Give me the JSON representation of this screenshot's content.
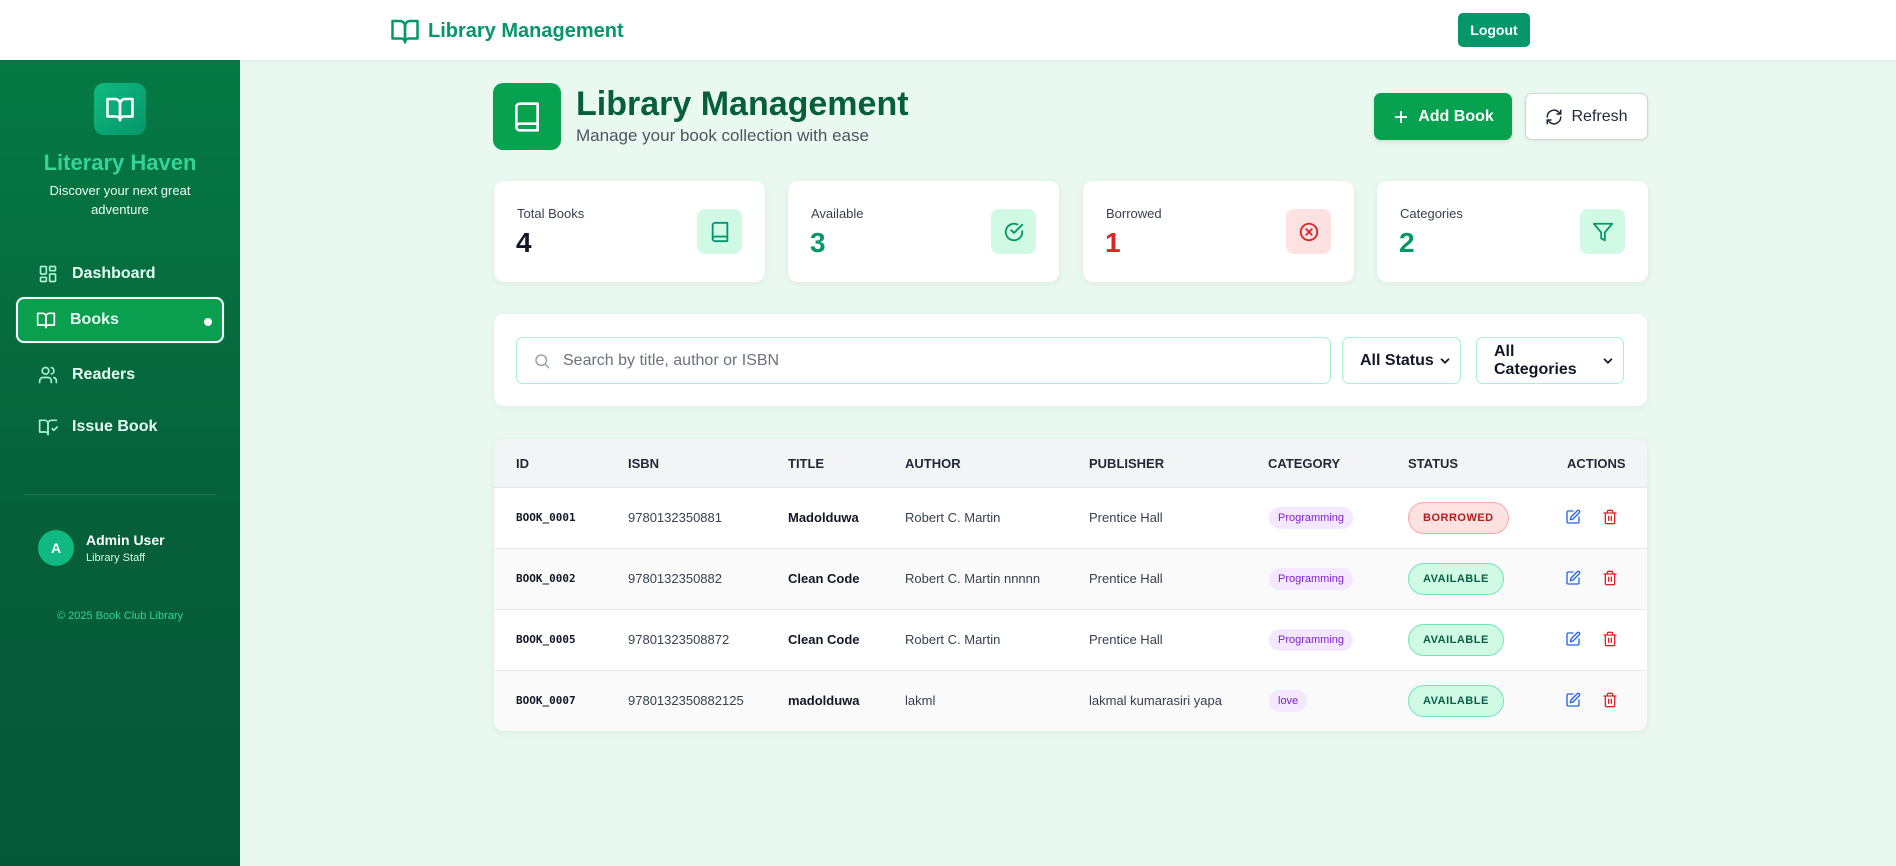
{
  "topbar": {
    "brand": "Library Management",
    "logout_label": "Logout"
  },
  "sidebar": {
    "title": "Literary Haven",
    "subtitle": "Discover your next great adventure",
    "items": [
      {
        "label": "Dashboard",
        "icon": "dashboard-icon"
      },
      {
        "label": "Books",
        "icon": "book-open-icon",
        "active": true
      },
      {
        "label": "Readers",
        "icon": "users-icon"
      },
      {
        "label": "Issue Book",
        "icon": "book-issue-icon"
      }
    ],
    "user": {
      "initial": "A",
      "name": "Admin User",
      "role": "Library Staff"
    },
    "copyright": "© 2025 Book Club Library"
  },
  "header": {
    "title": "Library Management",
    "subtitle": "Manage your book collection with ease",
    "add_label": "Add Book",
    "refresh_label": "Refresh"
  },
  "stats": [
    {
      "label": "Total Books",
      "value": "4",
      "color": "#111827",
      "icon": "book-icon"
    },
    {
      "label": "Available",
      "value": "3",
      "color": "#059669",
      "icon": "check-circle-icon"
    },
    {
      "label": "Borrowed",
      "value": "1",
      "color": "#dc2626",
      "icon": "x-circle-icon"
    },
    {
      "label": "Categories",
      "value": "2",
      "color": "#059669",
      "icon": "filter-icon"
    }
  ],
  "filters": {
    "search_placeholder": "Search by title, author or ISBN",
    "status_selected": "All Status",
    "category_selected": "All Categories"
  },
  "table": {
    "columns": [
      "ID",
      "ISBN",
      "TITLE",
      "AUTHOR",
      "PUBLISHER",
      "CATEGORY",
      "STATUS",
      "ACTIONS"
    ],
    "rows": [
      {
        "id": "BOOK_0001",
        "isbn": "9780132350881",
        "title": "Madolduwa",
        "author": "Robert C. Martin",
        "publisher": "Prentice Hall",
        "category": "Programming",
        "status": "BORROWED"
      },
      {
        "id": "BOOK_0002",
        "isbn": "9780132350882",
        "title": "Clean Code",
        "author": "Robert C. Martin nnnnn",
        "publisher": "Prentice Hall",
        "category": "Programming",
        "status": "AVAILABLE"
      },
      {
        "id": "BOOK_0005",
        "isbn": "97801323508872",
        "title": "Clean Code",
        "author": "Robert C. Martin",
        "publisher": "Prentice Hall",
        "category": "Programming",
        "status": "AVAILABLE"
      },
      {
        "id": "BOOK_0007",
        "isbn": "9780132350882125",
        "title": "madolduwa",
        "author": "lakml",
        "publisher": "lakmal kumarasiri yapa",
        "category": "love",
        "status": "AVAILABLE"
      }
    ]
  },
  "colors": {
    "primary": "#059669",
    "sidebar": "#065f3a",
    "danger": "#dc2626",
    "edit": "#2563eb"
  }
}
